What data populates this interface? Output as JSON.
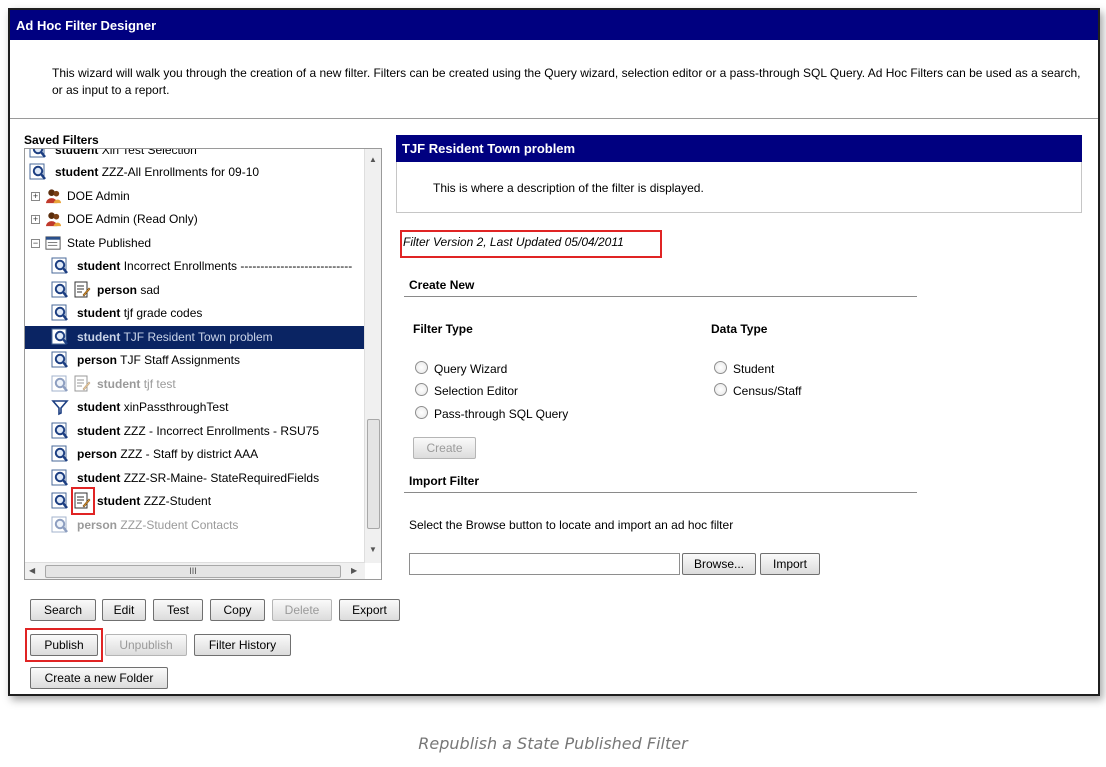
{
  "window": {
    "title": "Ad Hoc Filter Designer",
    "intro": "This wizard will walk you through the creation of a new filter. Filters can be created using the Query wizard, selection editor or a pass-through SQL Query. Ad Hoc Filters can be used as a search, or as input to a report."
  },
  "saved_filters": {
    "label": "Saved Filters",
    "items": [
      {
        "kind": "student",
        "name": "Xin Test Selection",
        "icon": "query-wizard-icon"
      },
      {
        "kind": "student",
        "name": "ZZZ-All Enrollments for 09-10",
        "icon": "query-wizard-icon"
      },
      {
        "kind": "",
        "name": "DOE Admin",
        "icon": "user-group-folder-icon",
        "expander": "+"
      },
      {
        "kind": "",
        "name": "DOE Admin (Read Only)",
        "icon": "user-group-folder-icon",
        "expander": "+"
      },
      {
        "kind": "",
        "name": "State Published",
        "icon": "state-published-folder-icon",
        "expander": "−"
      },
      {
        "kind": "student",
        "name": "Incorrect Enrollments ----------------------------",
        "icon": "query-wizard-icon"
      },
      {
        "kind": "person",
        "name": "sad",
        "icon": "selection-editor-icon"
      },
      {
        "kind": "student",
        "name": "tjf grade codes",
        "icon": "query-wizard-icon"
      },
      {
        "kind": "student",
        "name": "TJF Resident Town problem",
        "icon": "query-wizard-icon",
        "selected": true
      },
      {
        "kind": "person",
        "name": "TJF Staff Assignments",
        "icon": "query-wizard-icon"
      },
      {
        "kind": "student",
        "name": "tjf test",
        "icon": "selection-editor-icon",
        "dim": true
      },
      {
        "kind": "student",
        "name": "xinPassthroughTest",
        "icon": "sql-passthrough-filter-icon"
      },
      {
        "kind": "student",
        "name": "ZZZ - Incorrect Enrollments - RSU75",
        "icon": "query-wizard-icon"
      },
      {
        "kind": "person",
        "name": "ZZZ - Staff by district AAA",
        "icon": "query-wizard-icon"
      },
      {
        "kind": "student",
        "name": "ZZZ-SR-Maine- StateRequiredFields",
        "icon": "query-wizard-icon"
      },
      {
        "kind": "student",
        "name": "ZZZ-Student",
        "icon": "selection-editor-icon"
      },
      {
        "kind": "person",
        "name": "ZZZ-Student Contacts",
        "icon": "query-wizard-icon",
        "dim": true
      }
    ],
    "hscroll_grip": "III"
  },
  "buttons": {
    "search": "Search",
    "edit": "Edit",
    "test": "Test",
    "copy": "Copy",
    "delete": "Delete",
    "export": "Export",
    "publish": "Publish",
    "unpublish": "Unpublish",
    "filter_history": "Filter History",
    "create_folder": "Create a new Folder"
  },
  "detail": {
    "title": "TJF Resident Town problem",
    "description": "This is where a description of the filter is displayed.",
    "version": "Filter Version 2,  Last Updated 05/04/2011"
  },
  "create_new": {
    "title": "Create New",
    "filter_type_label": "Filter Type",
    "data_type_label": "Data Type",
    "filter_types": [
      "Query Wizard",
      "Selection Editor",
      "Pass-through SQL Query"
    ],
    "data_types": [
      "Student",
      "Census/Staff"
    ],
    "create_button": "Create"
  },
  "import_filter": {
    "title": "Import Filter",
    "instructions": "Select the Browse button to locate and import an ad hoc filter",
    "file_value": "",
    "browse_button": "Browse...",
    "import_button": "Import"
  },
  "caption": "Republish a State Published Filter",
  "colors": {
    "titlebar": "#000080",
    "selected_row": "#0a2463",
    "highlight": "#e02424"
  }
}
